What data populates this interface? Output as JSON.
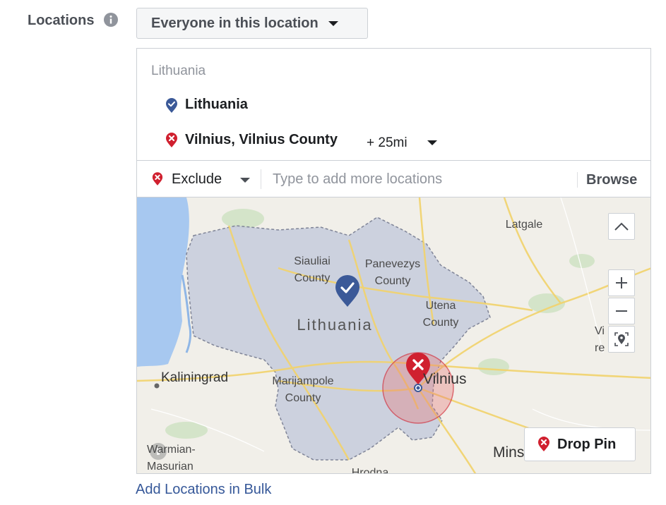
{
  "field": {
    "label": "Locations",
    "info_icon": "info-icon"
  },
  "audience_dropdown": {
    "label": "Everyone in this location"
  },
  "selected": {
    "country_heading": "Lithuania",
    "items": [
      {
        "name": "Lithuania",
        "type": "include",
        "icon": "include-pin-icon"
      },
      {
        "name": "Vilnius, Vilnius County",
        "type": "exclude",
        "icon": "exclude-pin-icon",
        "radius": "+ 25mi"
      }
    ]
  },
  "input_row": {
    "mode_label": "Exclude",
    "placeholder": "Type to add more locations",
    "browse_label": "Browse"
  },
  "map": {
    "labels": {
      "latgale": "Latgale",
      "siauliai": "Siauliai\nCounty",
      "panevezys": "Panevezys\nCounty",
      "lithuania": "Lithuania",
      "utena": "Utena\nCounty",
      "vi": "Vi\nre",
      "kaliningrad": "Kaliningrad",
      "marijampole": "Marijampole\nCounty",
      "vilnius": "Vilnius",
      "warmian": "Warmian-\nMasurian",
      "hrodna": "Hrodna",
      "minsk": "Mins"
    },
    "drop_pin_label": "Drop Pin",
    "controls": [
      "chevron-up-icon",
      "plus-icon",
      "minus-icon",
      "locate-icon"
    ],
    "colors": {
      "include": "#3b5998",
      "exclude": "#d0202f",
      "country_fill": "#c5cbdc",
      "water": "#a7c8f0"
    }
  },
  "bulk_link": "Add Locations in Bulk"
}
